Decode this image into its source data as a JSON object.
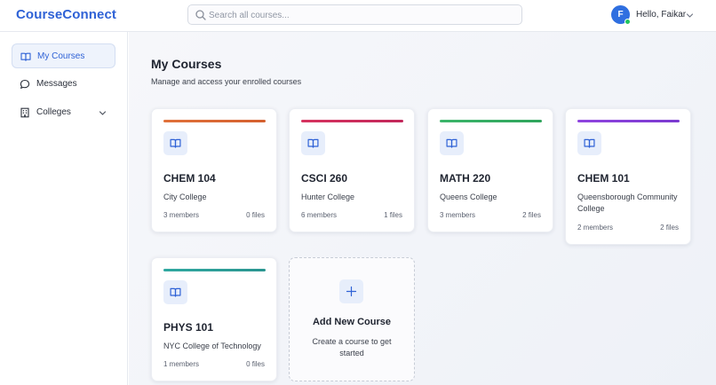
{
  "header": {
    "logo": "CourseConnect",
    "search_placeholder": "Search all courses...",
    "user": {
      "initial": "F",
      "greeting": "Hello, Faikar",
      "status": "online"
    }
  },
  "sidebar": {
    "items": [
      {
        "label": "My Courses",
        "icon": "book-icon",
        "active": true
      },
      {
        "label": "Messages",
        "icon": "chat-icon",
        "active": false
      },
      {
        "label": "Colleges",
        "icon": "building-icon",
        "active": false,
        "expandable": true
      }
    ]
  },
  "main": {
    "title": "My Courses",
    "subtitle": "Manage and access your enrolled courses",
    "courses": [
      {
        "code": "CHEM 104",
        "college": "City College",
        "members": "3 members",
        "files": "0 files",
        "accent": "#e0713a"
      },
      {
        "code": "CSCI 260",
        "college": "Hunter College",
        "members": "6 members",
        "files": "1 files",
        "accent": "#d6335f"
      },
      {
        "code": "MATH 220",
        "college": "Queens College",
        "members": "3 members",
        "files": "2 files",
        "accent": "#3bb56a"
      },
      {
        "code": "CHEM 101",
        "college": "Queensborough Community College",
        "members": "2 members",
        "files": "2 files",
        "accent": "#8f44df"
      },
      {
        "code": "PHYS 101",
        "college": "NYC College of Technology",
        "members": "1 members",
        "files": "0 files",
        "accent": "#2fa8a0"
      }
    ],
    "add_course": {
      "title": "Add New Course",
      "description": "Create a course to get started"
    }
  },
  "colors": {
    "brand": "#2f62d6",
    "icon_bg": "#e7eefb",
    "status_online": "#22c55e"
  }
}
